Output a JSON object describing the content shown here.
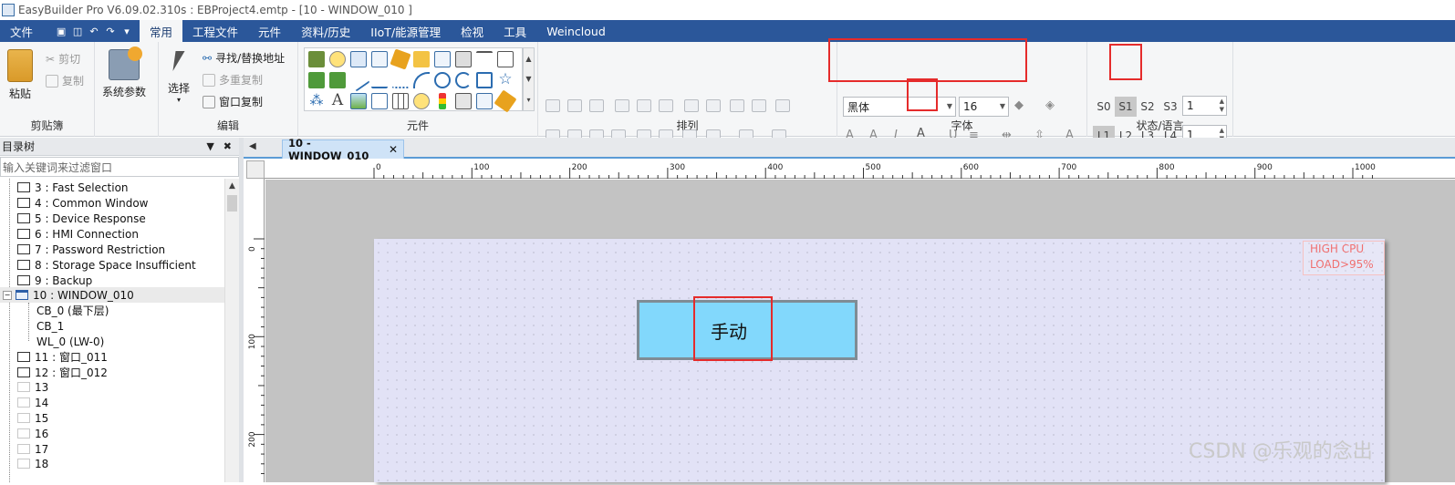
{
  "titlebar": {
    "title": "EasyBuilder Pro V6.09.02.310s : EBProject4.emtp - [10 - WINDOW_010 ]"
  },
  "menu": {
    "file": "文件",
    "tabs": [
      "常用",
      "工程文件",
      "元件",
      "资料/历史",
      "IIoT/能源管理",
      "检视",
      "工具",
      "Weincloud"
    ],
    "active_tab": "常用"
  },
  "ribbon": {
    "clipboard": {
      "paste": "粘贴",
      "cut": "剪切",
      "copy": "复制",
      "group": "剪贴簿"
    },
    "system": {
      "label": "系统参数"
    },
    "edit": {
      "select": "选择",
      "find_replace": "寻找/替换地址",
      "multi_copy": "多重复制",
      "window_copy": "窗口复制",
      "group": "编辑"
    },
    "objects": {
      "group": "元件"
    },
    "arrange": {
      "group": "排列"
    },
    "font": {
      "family": "黑体",
      "size": "16",
      "group": "字体"
    },
    "state_lang": {
      "states": [
        "S0",
        "S1",
        "S2",
        "S3"
      ],
      "selected_state": "S1",
      "state_value": "1",
      "langs": [
        "L1",
        "L2",
        "L3",
        "L4"
      ],
      "selected_lang": "L1",
      "lang_value": "1",
      "group": "状态/语言"
    }
  },
  "tree": {
    "header": "目录树",
    "filter_placeholder": "输入关键词来过滤窗口",
    "items": [
      {
        "label": "3 : Fast Selection"
      },
      {
        "label": "4 : Common Window"
      },
      {
        "label": "5 : Device Response"
      },
      {
        "label": "6 : HMI Connection"
      },
      {
        "label": "7 : Password Restriction"
      },
      {
        "label": "8 : Storage Space Insufficient"
      },
      {
        "label": "9 : Backup"
      },
      {
        "label": "10 : WINDOW_010"
      },
      {
        "label": "CB_0 (最下层)"
      },
      {
        "label": "CB_1"
      },
      {
        "label": "WL_0 (LW-0)"
      },
      {
        "label": "11 : 窗口_011"
      },
      {
        "label": "12 : 窗口_012"
      },
      {
        "label": "13"
      },
      {
        "label": "14"
      },
      {
        "label": "15"
      },
      {
        "label": "16"
      },
      {
        "label": "17"
      },
      {
        "label": "18"
      }
    ]
  },
  "editor": {
    "tab_label": "10 - WINDOW_010",
    "ruler_h": [
      "0",
      "100",
      "200",
      "300",
      "400",
      "500",
      "600",
      "700",
      "800",
      "900",
      "1000"
    ],
    "ruler_v": [
      "0",
      "100",
      "200"
    ],
    "button_text": "手动",
    "cpu_warning_line1": "HIGH CPU",
    "cpu_warning_line2": "LOAD>95%"
  },
  "watermark": "CSDN @乐观的念出",
  "colors": {
    "menubar": "#2b579a",
    "hmi_button": "#82d8fc",
    "highlight": "#e52b2b",
    "tab_accent": "#5b9bd5"
  }
}
